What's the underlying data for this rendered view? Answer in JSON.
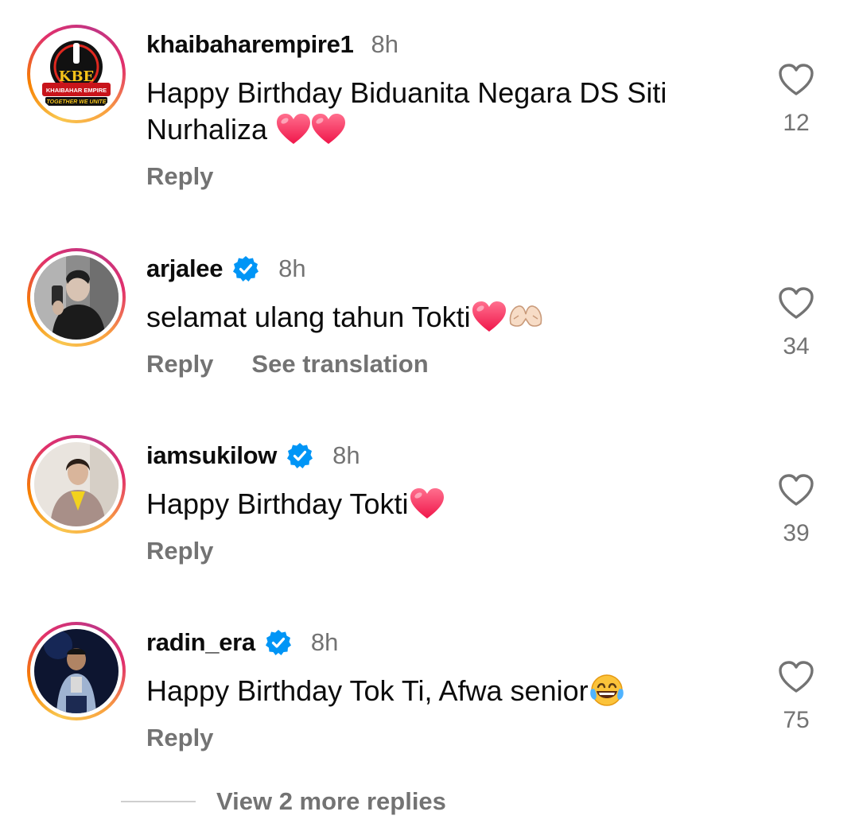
{
  "comments": [
    {
      "username": "khaibaharempire1",
      "verified": false,
      "time": "8h",
      "text_line1": "Happy Birthday Biduanita Negara DS Siti",
      "text_line2": "Nurhaliza",
      "emojis": [
        "heart-emoji",
        "heart-emoji"
      ],
      "actions": [
        "Reply"
      ],
      "likes": "12",
      "avatar_text": {
        "top": "KBE",
        "middle": "KHAIBAHAR EMPIRE",
        "bottom": "TOGETHER WE UNITE"
      }
    },
    {
      "username": "arjalee",
      "verified": true,
      "time": "8h",
      "text_line1": "selamat ulang tahun Tokti",
      "emojis": [
        "heart-emoji",
        "heart-hands-emoji"
      ],
      "actions": [
        "Reply",
        "See translation"
      ],
      "likes": "34"
    },
    {
      "username": "iamsukilow",
      "verified": true,
      "time": "8h",
      "text_line1": "Happy Birthday Tokti",
      "emojis": [
        "heart-emoji"
      ],
      "actions": [
        "Reply"
      ],
      "likes": "39"
    },
    {
      "username": "radin_era",
      "verified": true,
      "time": "8h",
      "text_line1": "Happy Birthday Tok Ti, Afwa senior",
      "emojis": [
        "tears-of-joy-emoji"
      ],
      "actions": [
        "Reply"
      ],
      "likes": "75"
    }
  ],
  "view_more_replies": "View 2 more replies",
  "colors": {
    "text": "#0c0c0c",
    "secondary": "#737373",
    "verified": "#0095f6",
    "heart": "#ff3b5c"
  }
}
